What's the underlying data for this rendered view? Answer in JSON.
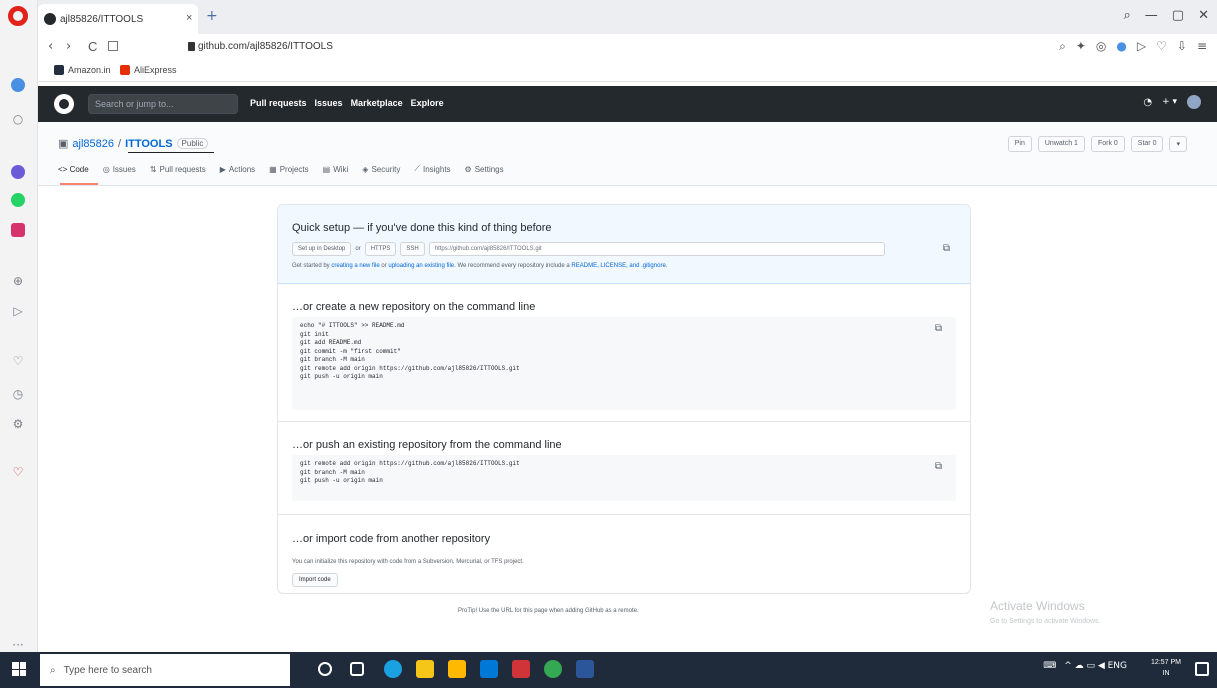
{
  "browser": {
    "tab_title": "ajl85826/ITTOOLS",
    "tab_close": "×",
    "new_tab": "+",
    "window_controls": [
      "⌕",
      "—",
      "▢",
      "✕"
    ],
    "url": "github.com/ajl85826/ITTOOLS",
    "nav": {
      "back": "‹",
      "forward": "›",
      "reload": "C"
    },
    "actions": [
      "⌕",
      "✦",
      "◎",
      "●",
      "▷",
      "♡",
      "⇩",
      "≡"
    ],
    "bookmarks": [
      {
        "label": "Amazon.in",
        "color": "#232f3e"
      },
      {
        "label": "AliExpress",
        "color": "#e62e04"
      }
    ]
  },
  "sidebar_icons": [
    "◈",
    "○",
    "◉",
    "●",
    "▣",
    "⊕",
    "▷",
    "♡",
    "◷",
    "⚙",
    "♡",
    "···"
  ],
  "github": {
    "search_placeholder": "Search or jump to...",
    "nav": [
      "Pull requests",
      "Issues",
      "Marketplace",
      "Explore"
    ],
    "right_icons": [
      "🔔",
      "+ ▾"
    ],
    "repo": {
      "owner": "ajl85826",
      "separator": " / ",
      "name": "ITTOOLS",
      "visibility": "Public"
    },
    "repo_actions": [
      "Pin",
      "Unwatch 1",
      "Fork 0",
      "Star 0",
      "▾"
    ],
    "tabs": [
      "<> Code",
      "Issues",
      "Pull requests",
      "Actions",
      "Projects",
      "Wiki",
      "Security",
      "Insights",
      "Settings"
    ],
    "quick_setup": {
      "title": "Quick setup — if you've done this kind of thing before",
      "desktop_btn": "Set up in Desktop",
      "or": "or",
      "https": "HTTPS",
      "ssh": "SSH",
      "clone_url": "https://github.com/ajl85826/ITTOOLS.git",
      "hint_prefix": "Get started by ",
      "hint_link1": "creating a new file",
      "hint_mid1": " or ",
      "hint_link2": "uploading an existing file",
      "hint_mid2": ". We recommend every repository include a ",
      "hint_link3": "README, LICENSE, and .gitignore",
      "hint_suffix": "."
    },
    "new_repo": {
      "title": "…or create a new repository on the command line",
      "code": [
        "echo \"# ITTOOLS\" >> README.md",
        "git init",
        "git add README.md",
        "git commit -m \"first commit\"",
        "git branch -M main",
        "git remote add origin https://github.com/ajl85826/ITTOOLS.git",
        "git push -u origin main"
      ]
    },
    "push_repo": {
      "title": "…or push an existing repository from the command line",
      "code": [
        "git remote add origin https://github.com/ajl85826/ITTOOLS.git",
        "git branch -M main",
        "git push -u origin main"
      ]
    },
    "import_repo": {
      "title": "…or import code from another repository",
      "desc": "You can initialize this repository with code from a Subversion, Mercurial, or TFS project.",
      "button": "Import code"
    },
    "protip": "ProTip! Use the URL for this page when adding GitHub as a remote."
  },
  "watermark": {
    "title": "Activate Windows",
    "sub": "Go to Settings to activate Windows."
  },
  "taskbar": {
    "search_placeholder": "Type here to search",
    "tray": "^ ☁ ▭ ◀ ENG",
    "time": "12:57 PM",
    "lang": "IN"
  }
}
